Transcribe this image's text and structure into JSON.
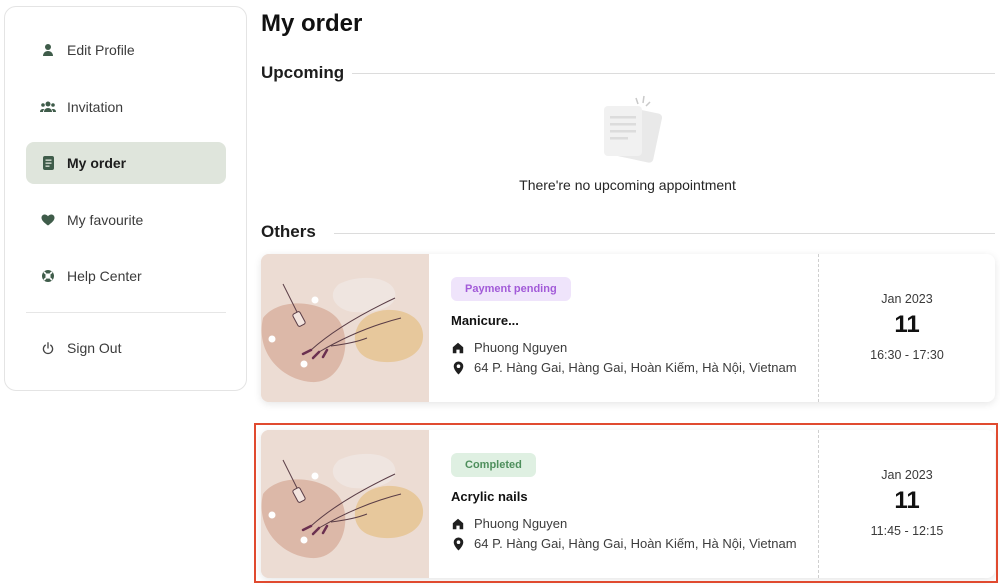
{
  "sidebar": {
    "items": [
      {
        "label": "Edit Profile",
        "icon": "person-icon"
      },
      {
        "label": "Invitation",
        "icon": "group-icon"
      },
      {
        "label": "My order",
        "icon": "order-list-icon",
        "active": true
      },
      {
        "label": "My favourite",
        "icon": "heart-icon"
      },
      {
        "label": "Help Center",
        "icon": "lifebuoy-icon"
      }
    ],
    "sign_out": {
      "label": "Sign Out",
      "icon": "power-icon"
    }
  },
  "main": {
    "title": "My order",
    "upcoming": {
      "heading": "Upcoming",
      "empty_text": "There're no upcoming appointment"
    },
    "others": {
      "heading": "Others",
      "orders": [
        {
          "status": "Payment pending",
          "service": "Manicure...",
          "provider": "Phuong Nguyen",
          "address": "64 P. Hàng Gai, Hàng Gai, Hoàn Kiếm, Hà Nội, Vietnam",
          "month": "Jan 2023",
          "day": "11",
          "time": "16:30 - 17:30"
        },
        {
          "status": "Completed",
          "service": "Acrylic nails",
          "provider": "Phuong Nguyen",
          "address": "64 P. Hàng Gai, Hàng Gai, Hoàn Kiếm, Hà Nội, Vietnam",
          "month": "Jan 2023",
          "day": "11",
          "time": "11:45 - 12:15"
        }
      ]
    }
  },
  "colors": {
    "active_nav_bg": "#dfe5dc",
    "sidebar_icon": "#3f5c4a",
    "pending_badge_bg": "#efe4fb",
    "pending_badge_text": "#a25ad8",
    "completed_badge_bg": "#dff0e2",
    "completed_badge_text": "#4e8f5c",
    "highlight": "#e04a2f"
  }
}
